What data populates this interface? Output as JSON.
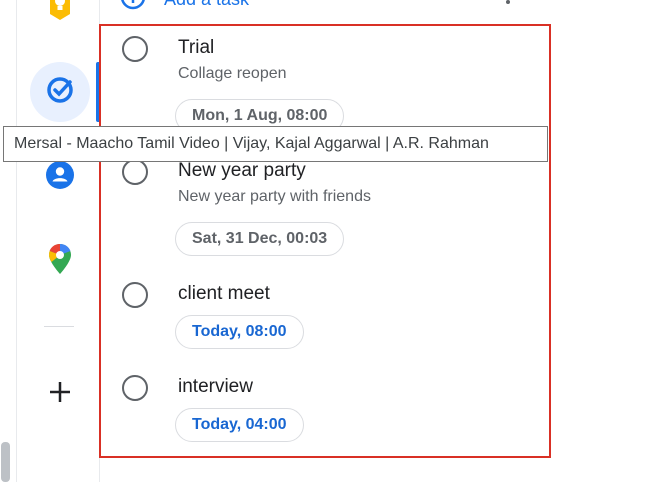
{
  "add_task": {
    "label": "Add a task"
  },
  "rail": {
    "items": [
      {
        "name": "keep",
        "icon": "keep-icon"
      },
      {
        "name": "tasks",
        "icon": "tasks-icon",
        "active": true
      },
      {
        "name": "contacts",
        "icon": "contacts-icon"
      },
      {
        "name": "maps",
        "icon": "maps-pin-icon"
      },
      {
        "name": "add",
        "icon": "plus-icon"
      }
    ]
  },
  "tasks": [
    {
      "title": "Trial",
      "notes": "Collage reopen",
      "date": "Mon, 1 Aug, 08:00",
      "date_status": "past"
    },
    {
      "title": "New year party",
      "notes": "New year party with friends",
      "date": "Sat, 31 Dec, 00:03",
      "date_status": "past"
    },
    {
      "title": "client meet",
      "notes": "",
      "date": "Today, 08:00",
      "date_status": "today"
    },
    {
      "title": "interview",
      "notes": "",
      "date": "Today, 04:00",
      "date_status": "today"
    }
  ],
  "tooltip": {
    "text": "Mersal - Maacho Tamil Video | Vijay, Kajal Aggarwal | A.R. Rahman"
  },
  "colors": {
    "accent": "#1a73e8",
    "today_chip": "#1967d2",
    "highlight": "#d93025"
  }
}
